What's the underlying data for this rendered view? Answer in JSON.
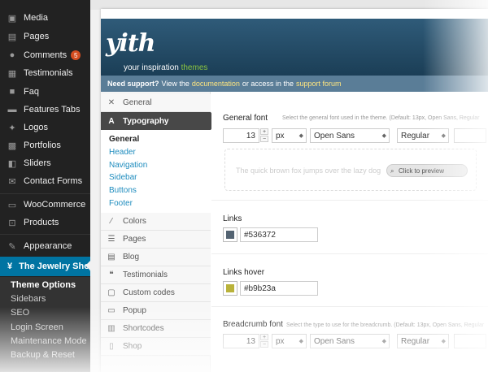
{
  "sidebar": {
    "items": [
      {
        "label": "Media",
        "icon": "media-icon"
      },
      {
        "label": "Pages",
        "icon": "pages-icon"
      },
      {
        "label": "Comments",
        "icon": "comments-icon",
        "badge": "5"
      },
      {
        "label": "Testimonials",
        "icon": "testimonials-icon"
      },
      {
        "label": "Faq",
        "icon": "faq-icon"
      },
      {
        "label": "Features Tabs",
        "icon": "features-tabs-icon"
      },
      {
        "label": "Logos",
        "icon": "logos-icon"
      },
      {
        "label": "Portfolios",
        "icon": "portfolios-icon"
      },
      {
        "label": "Sliders",
        "icon": "sliders-icon"
      },
      {
        "label": "Contact Forms",
        "icon": "contact-forms-icon"
      },
      {
        "label": "WooCommerce",
        "icon": "woocommerce-icon"
      },
      {
        "label": "Products",
        "icon": "products-icon"
      },
      {
        "label": "Appearance",
        "icon": "appearance-icon"
      },
      {
        "label": "The Jewelry Shop",
        "icon": "theme-icon"
      }
    ],
    "submenu": [
      "Theme Options",
      "Sidebars",
      "SEO",
      "Login Screen",
      "Maintenance Mode",
      "Backup & Reset"
    ]
  },
  "header": {
    "logo": "yith",
    "tagline_prefix": "your inspiration",
    "tagline_suffix": "themes"
  },
  "support": {
    "lead": "Need support?",
    "text1": "View the",
    "link1": "documentation",
    "text2": "or access in the",
    "link2": "support forum"
  },
  "nav": {
    "general": "General",
    "typography": "Typography",
    "typography_sub": [
      "General",
      "Header",
      "Navigation",
      "Sidebar",
      "Buttons",
      "Footer"
    ],
    "sections": [
      "Colors",
      "Pages",
      "Blog",
      "Testimonials",
      "Custom codes",
      "Popup",
      "Shortcodes",
      "Shop"
    ]
  },
  "content": {
    "general_font": {
      "label": "General font",
      "hint": "Select the general font used in the theme. (Default: 13px, Open Sans, Regular",
      "size": "13",
      "unit": "px",
      "family": "Open Sans",
      "weight": "Regular"
    },
    "preview": {
      "text": "The quick brown fox jumps over the lazy dog",
      "button": "Click to preview"
    },
    "links": {
      "label": "Links",
      "value": "#536372",
      "color": "#536372"
    },
    "links_hover": {
      "label": "Links hover",
      "value": "#b9b23a",
      "color": "#b9b23a"
    },
    "breadcrumb_font": {
      "label": "Breadcrumb font",
      "hint": "Select the type to use for the breadcrumb. (Default: 13px, Open Sans, Regular",
      "size": "13",
      "unit": "px",
      "family": "Open Sans",
      "weight": "Regular"
    }
  }
}
